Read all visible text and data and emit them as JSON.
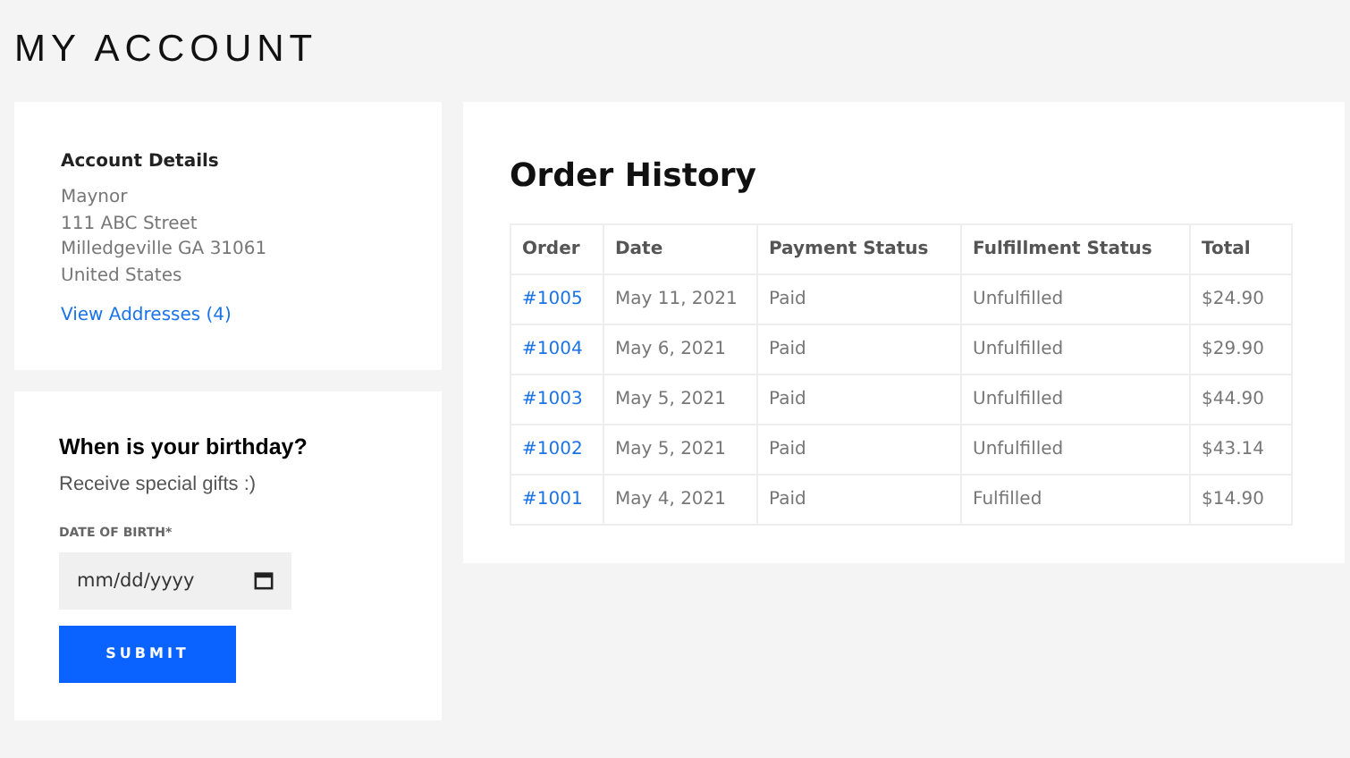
{
  "page_title": "MY ACCOUNT",
  "account_details": {
    "heading": "Account Details",
    "address_lines": [
      "Maynor",
      "111 ABC Street",
      "Milledgeville GA 31061",
      "United States"
    ],
    "link": "View Addresses (4)"
  },
  "birthday": {
    "heading": "When is your birthday?",
    "subtitle": "Receive special gifts :)",
    "field_label": "DATE OF BIRTH*",
    "placeholder": "mm/dd/yyyy",
    "button": "SUBMIT"
  },
  "order_history": {
    "heading": "Order History",
    "columns": [
      "Order",
      "Date",
      "Payment Status",
      "Fulfillment Status",
      "Total"
    ],
    "rows": [
      {
        "order": "#1005",
        "date": "May 11, 2021",
        "payment": "Paid",
        "fulfillment": "Unfulfilled",
        "total": "$24.90"
      },
      {
        "order": "#1004",
        "date": "May 6, 2021",
        "payment": "Paid",
        "fulfillment": "Unfulfilled",
        "total": "$29.90"
      },
      {
        "order": "#1003",
        "date": "May 5, 2021",
        "payment": "Paid",
        "fulfillment": "Unfulfilled",
        "total": "$44.90"
      },
      {
        "order": "#1002",
        "date": "May 5, 2021",
        "payment": "Paid",
        "fulfillment": "Unfulfilled",
        "total": "$43.14"
      },
      {
        "order": "#1001",
        "date": "May 4, 2021",
        "payment": "Paid",
        "fulfillment": "Fulfilled",
        "total": "$14.90"
      }
    ]
  }
}
